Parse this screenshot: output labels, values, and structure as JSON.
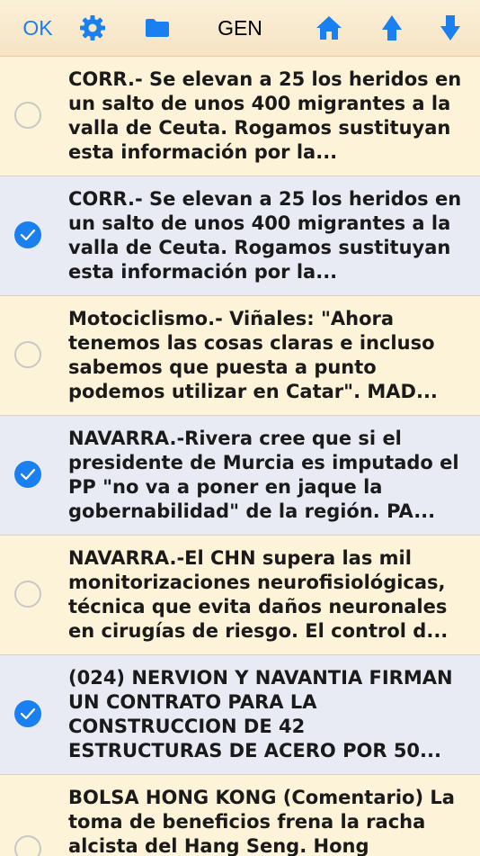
{
  "toolbar": {
    "ok_label": "OK",
    "gen_label": "GEN",
    "icons": [
      "gear-icon",
      "folder-icon",
      "home-icon",
      "arrow-up-icon",
      "arrow-down-icon"
    ],
    "accent_color": "#1a7ff0"
  },
  "items": [
    {
      "text": "CORR.- Se elevan a 25 los heridos en un salto de unos 400 migrantes a la valla de Ceuta.  Rogamos sustituyan esta información por la...",
      "selected": false
    },
    {
      "text": "CORR.- Se elevan a 25 los heridos en un salto de unos 400 migrantes a la valla de Ceuta.  Rogamos sustituyan esta información por la...",
      "selected": true
    },
    {
      "text": "Motociclismo.- Viñales: \"Ahora tenemos las cosas claras e incluso sabemos que puesta a punto podemos utilizar en Catar\".   MAD...",
      "selected": false
    },
    {
      "text": "NAVARRA.-Rivera cree que si el presidente de Murcia es imputado el PP \"no va a poner en jaque la gobernabilidad\" de la región.  PA...",
      "selected": true
    },
    {
      "text": "NAVARRA.-El CHN supera las mil monitorizaciones neurofisiológicas, técnica que evita daños neuronales en cirugías de riesgo.  El control d...",
      "selected": false
    },
    {
      "text": "(024) NERVION Y NAVANTIA FIRMAN UN CONTRATO PARA LA CONSTRUCCION DE 42 ESTRUCTURAS DE ACERO POR 50...",
      "selected": true
    },
    {
      "text": "BOLSA HONG KONG (Comentario) La toma de beneficios frena la racha alcista del Hang Seng.  Hong",
      "selected": false
    }
  ]
}
